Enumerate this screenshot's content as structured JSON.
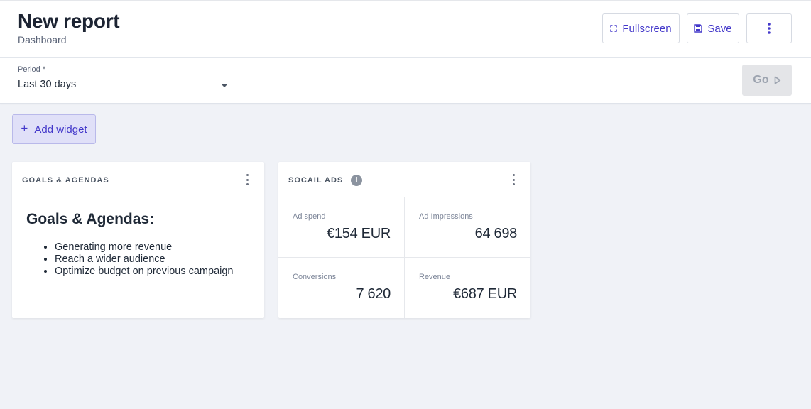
{
  "header": {
    "title": "New report",
    "subtitle": "Dashboard",
    "fullscreen_label": "Fullscreen",
    "save_label": "Save"
  },
  "filters": {
    "period_label": "Period",
    "period_required_mark": "*",
    "period_value": "Last 30 days",
    "go_label": "Go"
  },
  "toolbar": {
    "add_widget_label": "Add widget"
  },
  "widgets": {
    "goals": {
      "title": "GOALS & AGENDAS",
      "heading": "Goals & Agendas:",
      "items": [
        "Generating more revenue",
        "Reach a wider audience",
        "Optimize budget on previous campaign"
      ]
    },
    "ads": {
      "title": "SOCAIL ADS",
      "info_glyph": "i",
      "metrics": [
        {
          "label": "Ad spend",
          "value": "€154 EUR"
        },
        {
          "label": "Ad Impressions",
          "value": "64 698"
        },
        {
          "label": "Conversions",
          "value": "7 620"
        },
        {
          "label": "Revenue",
          "value": "€687 EUR"
        }
      ]
    }
  },
  "colors": {
    "accent": "#4338ca",
    "background": "#f0f2f7",
    "add_widget_bg": "#e0e0f8"
  },
  "icons": {
    "fullscreen": "fullscreen-icon",
    "save": "save-icon",
    "more": "kebab-menu-icon",
    "go": "play-triangle-icon",
    "info": "info-icon"
  }
}
